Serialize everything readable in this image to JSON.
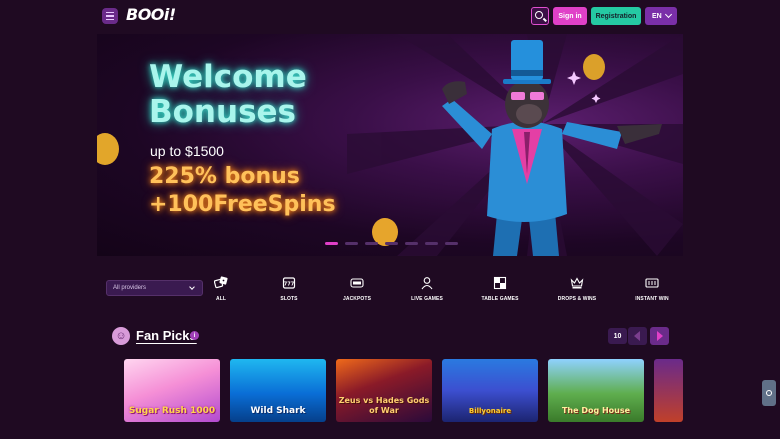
{
  "header": {
    "logo_text": "BOOi!",
    "signin_label": "Sign in",
    "register_label": "Registration",
    "language": "EN",
    "icons": [
      "menu-icon",
      "search-icon",
      "chevron-down-icon"
    ],
    "colors": {
      "signin": "#e040c8",
      "register": "#25c9a3",
      "language": "#7a2fa8"
    }
  },
  "hero": {
    "title_line1": "Welcome",
    "title_line2": "Bonuses",
    "subtitle": "up to $1500",
    "offer_line1": "225% bonus",
    "offer_line2": "+100FreeSpins",
    "slide_count": 7,
    "active_slide": 1,
    "colors": {
      "title": "#a9f5ec",
      "offer": "#ffc15a"
    }
  },
  "filters": {
    "provider_placeholder": "All providers",
    "categories": [
      {
        "label": "ALL",
        "icon": "dice-icon"
      },
      {
        "label": "SLOTS",
        "icon": "slot-machine-icon"
      },
      {
        "label": "JACKPOTS",
        "icon": "jackpot-icon"
      },
      {
        "label": "LIVE GAMES",
        "icon": "live-dealer-icon"
      },
      {
        "label": "TABLE GAMES",
        "icon": "table-games-icon"
      },
      {
        "label": "DROPS & WINS",
        "icon": "crown-icon"
      },
      {
        "label": "INSTANT WIN",
        "icon": "instant-win-icon"
      }
    ]
  },
  "fan_picks": {
    "title": "Fan Picks",
    "info_badge": "i",
    "count": "10",
    "games": [
      {
        "name": "Sugar Rush 1000"
      },
      {
        "name": "Wild Shark"
      },
      {
        "name": "Zeus vs Hades Gods of War"
      },
      {
        "name": "Billyonaire"
      },
      {
        "name": "The Dog House"
      },
      {
        "name": ""
      }
    ]
  }
}
